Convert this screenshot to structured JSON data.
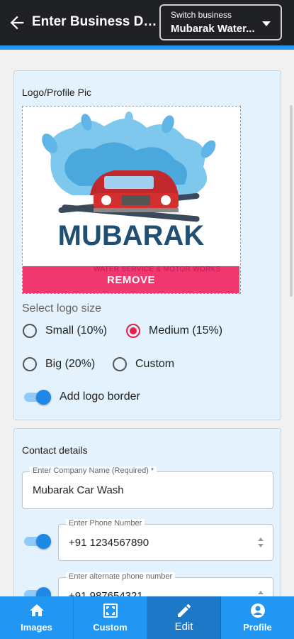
{
  "header": {
    "title": "Enter Business De...",
    "switch_label": "Switch business",
    "switch_value": "Mubarak Water..."
  },
  "logo_section": {
    "label": "Logo/Profile Pic",
    "logo_text": "MUBARAK",
    "logo_subtext": "WATER SERVICE & MOTOR WORKS",
    "remove_label": "REMOVE",
    "size_label": "Select logo size",
    "options": [
      {
        "label": "Small (10%)",
        "selected": false
      },
      {
        "label": "Medium (15%)",
        "selected": true
      },
      {
        "label": "Big (20%)",
        "selected": false
      },
      {
        "label": "Custom",
        "selected": false
      }
    ],
    "border_toggle_label": "Add logo border",
    "border_toggle_on": true
  },
  "contact": {
    "label": "Contact details",
    "company_label": "Enter Company Name (Required) *",
    "company_value": "Mubarak Car Wash",
    "phone_label": "Enter Phone Number",
    "phone_value": "+91  1234567890",
    "alt_phone_label": "Enter alternate phone number",
    "alt_phone_value": "+91  987654321"
  },
  "bottom_nav": [
    {
      "label": "Images",
      "icon": "home-icon",
      "active": false
    },
    {
      "label": "Custom",
      "icon": "crop-icon",
      "active": false
    },
    {
      "label": "Edit",
      "icon": "pencil-icon",
      "active": true
    },
    {
      "label": "Profile",
      "icon": "person-icon",
      "active": false
    }
  ],
  "colors": {
    "topbar": "#202124",
    "accent": "#2196f3",
    "remove": "#f0386f",
    "radio_selected": "#e91e4c",
    "card": "#e3f2fd"
  }
}
